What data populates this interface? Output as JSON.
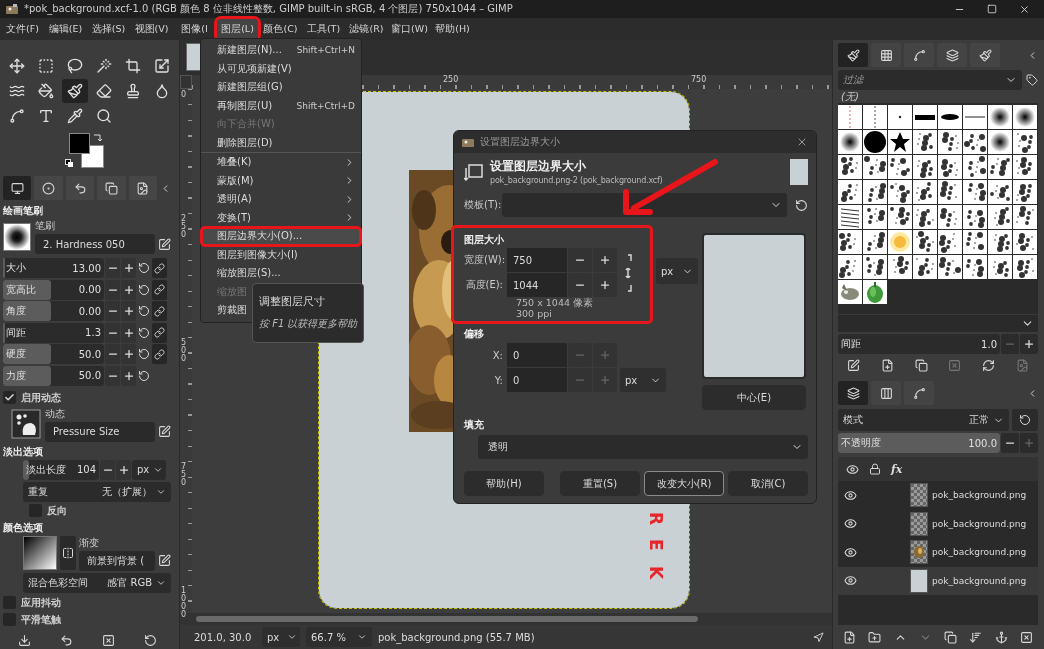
{
  "title_bar": {
    "title": "*pok_background.xcf-1.0 (RGB 颜色 8 位非线性整数, GIMP built-in sRGB, 4 个图层) 750x1044 – GIMP"
  },
  "menu_bar": [
    {
      "label": "文件(F)",
      "selected": false
    },
    {
      "label": "编辑(E)",
      "selected": false
    },
    {
      "label": "选择(S)",
      "selected": false
    },
    {
      "label": "视图(V)",
      "selected": false
    },
    {
      "label": "图像(I",
      "selected": false
    },
    {
      "label": "图层(L)",
      "selected": true
    },
    {
      "label": "颜色(C)",
      "selected": false
    },
    {
      "label": "工具(T)",
      "selected": false
    },
    {
      "label": "滤镜(R)",
      "selected": false
    },
    {
      "label": "窗口(W)",
      "selected": false
    },
    {
      "label": "帮助(H)",
      "selected": false
    }
  ],
  "layer_menu": [
    {
      "kind": "item",
      "label": "新建图层(N)...",
      "shortcut": "Shift+Ctrl+N",
      "disabled": false,
      "selected": false
    },
    {
      "kind": "item",
      "label": "从可见项新建(V)",
      "disabled": false,
      "selected": false
    },
    {
      "kind": "item",
      "label": "新建图层组(G)",
      "disabled": false,
      "selected": false
    },
    {
      "kind": "item",
      "label": "再制图层(U)",
      "shortcut": "Shift+Ctrl+D",
      "disabled": false,
      "selected": false
    },
    {
      "kind": "item",
      "label": "向下合并(W)",
      "disabled": true,
      "selected": false
    },
    {
      "kind": "item",
      "label": "删除图层(D)",
      "disabled": false,
      "selected": false
    },
    {
      "kind": "separator"
    },
    {
      "kind": "submenu",
      "label": "堆叠(K)",
      "disabled": false,
      "selected": false
    },
    {
      "kind": "submenu",
      "label": "蒙版(M)",
      "disabled": false,
      "selected": false
    },
    {
      "kind": "submenu",
      "label": "透明(A)",
      "disabled": false,
      "selected": false
    },
    {
      "kind": "submenu",
      "label": "变换(T)",
      "disabled": false,
      "selected": false
    },
    {
      "kind": "item",
      "label": "图层边界大小(O)...",
      "disabled": false,
      "selected": true
    },
    {
      "kind": "item",
      "label": "图层到图像大小(I)",
      "disabled": false,
      "selected": false
    },
    {
      "kind": "item",
      "label": "缩放图层(S)...",
      "disabled": false,
      "selected": false
    },
    {
      "kind": "item",
      "label": "缩放图",
      "disabled": true,
      "selected": false
    },
    {
      "kind": "item",
      "label": "剪裁图",
      "disabled": false,
      "selected": false
    }
  ],
  "tooltip": {
    "title": "调整图层尺寸",
    "hint": "按 F1 以获得更多帮助"
  },
  "tools": [
    {
      "selected": false
    },
    {
      "selected": false
    },
    {
      "selected": false
    },
    {
      "selected": false
    },
    {
      "selected": false
    },
    {
      "selected": false
    },
    {
      "selected": false
    },
    {
      "selected": false
    },
    {
      "selected": true
    },
    {
      "selected": false
    },
    {
      "selected": false
    },
    {
      "selected": false
    },
    {
      "selected": false
    },
    {
      "selected": false
    },
    {
      "selected": false
    },
    {
      "selected": false
    }
  ],
  "tool_options": {
    "tabs": [
      {
        "selected": true
      },
      {
        "selected": false
      },
      {
        "selected": false
      },
      {
        "selected": false
      },
      {
        "selected": false
      }
    ],
    "heading": "绘画笔刷",
    "brush_label": "笔刷",
    "brush": "2. Hardness 050",
    "sliders": [
      {
        "label": "大小",
        "value": "13.00",
        "level": 0.02,
        "linked": true
      },
      {
        "label": "宽高比",
        "value": "0.00",
        "level": 0.48,
        "linked": true
      },
      {
        "label": "角度",
        "value": "0.00",
        "level": 0.48,
        "linked": true
      },
      {
        "label": "间距",
        "value": "1.3",
        "level": 0.02,
        "linked": true
      },
      {
        "label": "硬度",
        "value": "50.0",
        "level": 0.48,
        "linked": true
      },
      {
        "label": "力度",
        "value": "50.0",
        "level": 0.48,
        "linked": false
      }
    ],
    "dynamics_toggle": {
      "label": "启用动态",
      "checked": true
    },
    "dynamics_label": "动态",
    "dynamics": "Pressure Size",
    "fade": {
      "heading": "淡出选项",
      "length": {
        "label": "淡出长度",
        "value": "104",
        "level": 0.08
      },
      "unit": "px",
      "repeat": {
        "label": "重复",
        "value": "无（扩展）"
      },
      "reverse": {
        "label": "反向",
        "checked": false
      }
    },
    "color": {
      "heading": "颜色选项",
      "gradient_label": "渐变",
      "gradient": "前景到背景 (",
      "blend": {
        "label": "混合色彩空间",
        "value": "感官 RGB"
      }
    },
    "jitter": {
      "label": "应用抖动",
      "checked": false
    },
    "smooth": {
      "label": "平滑笔触",
      "checked": false
    }
  },
  "canvas": {
    "top_ruler": [
      "250",
      "750"
    ],
    "left_ruler": [
      "0",
      "250",
      "500",
      "750",
      "1000"
    ],
    "image_letters": [
      "R",
      "E",
      "K"
    ]
  },
  "status_bar": {
    "coords": "201.0, 30.0",
    "unit": "px",
    "zoom": "66.7 %",
    "info": "pok_background.png (55.7 MB)"
  },
  "dialog": {
    "title": "设置图层边界大小",
    "heading": "设置图层边界大小",
    "subtitle": "pok_background.png-2 (pok_background.xcf)",
    "template_label": "模板(T):",
    "size_heading": "图层大小",
    "width": {
      "label": "宽度(W):",
      "value": "750"
    },
    "height": {
      "label": "高度(E):",
      "value": "1044"
    },
    "unit": "px",
    "pixels": "750 x 1044 像素",
    "resolution": "300 ppi",
    "offset_heading": "偏移",
    "offset_x": {
      "label": "X:",
      "value": "0",
      "disabled": true
    },
    "offset_y": {
      "label": "Y:",
      "value": "0",
      "disabled": true
    },
    "offset_unit": "px",
    "center_button": "中心(E)",
    "fill_heading": "填充",
    "fill": "透明",
    "buttons": [
      {
        "label": "帮助(H)",
        "selected": false
      },
      {
        "label": "重置(S)",
        "selected": false
      },
      {
        "label": "改变大小(R)",
        "selected": true
      },
      {
        "label": "取消(C)",
        "selected": false
      }
    ]
  },
  "brushes_panel": {
    "tabs": [
      {
        "selected": true
      },
      {
        "selected": false
      },
      {
        "selected": false
      },
      {
        "selected": false
      },
      {
        "selected": false
      }
    ],
    "filter_placeholder": "过滤",
    "tag": "(无)",
    "spacing": {
      "label": "间距",
      "value": "1.0",
      "decrease_disabled": true
    }
  },
  "layers_panel": {
    "tabs": [
      {
        "selected": true
      },
      {
        "selected": false
      },
      {
        "selected": false
      }
    ],
    "mode": {
      "label": "模式",
      "value": "正常"
    },
    "opacity": {
      "label": "不透明度",
      "value": "100.0",
      "level": 1,
      "increase_disabled": true
    },
    "effects_header": "fx",
    "layers": [
      {
        "name": "pok_background.png",
        "kind": "transparent",
        "visible": true,
        "selected": false
      },
      {
        "name": "pok_background.png",
        "kind": "transparent",
        "visible": true,
        "selected": false
      },
      {
        "name": "pok_background.png",
        "visible": true,
        "selected": false
      },
      {
        "name": "pok_background.png",
        "kind": "plain",
        "visible": true,
        "selected": true
      }
    ]
  }
}
